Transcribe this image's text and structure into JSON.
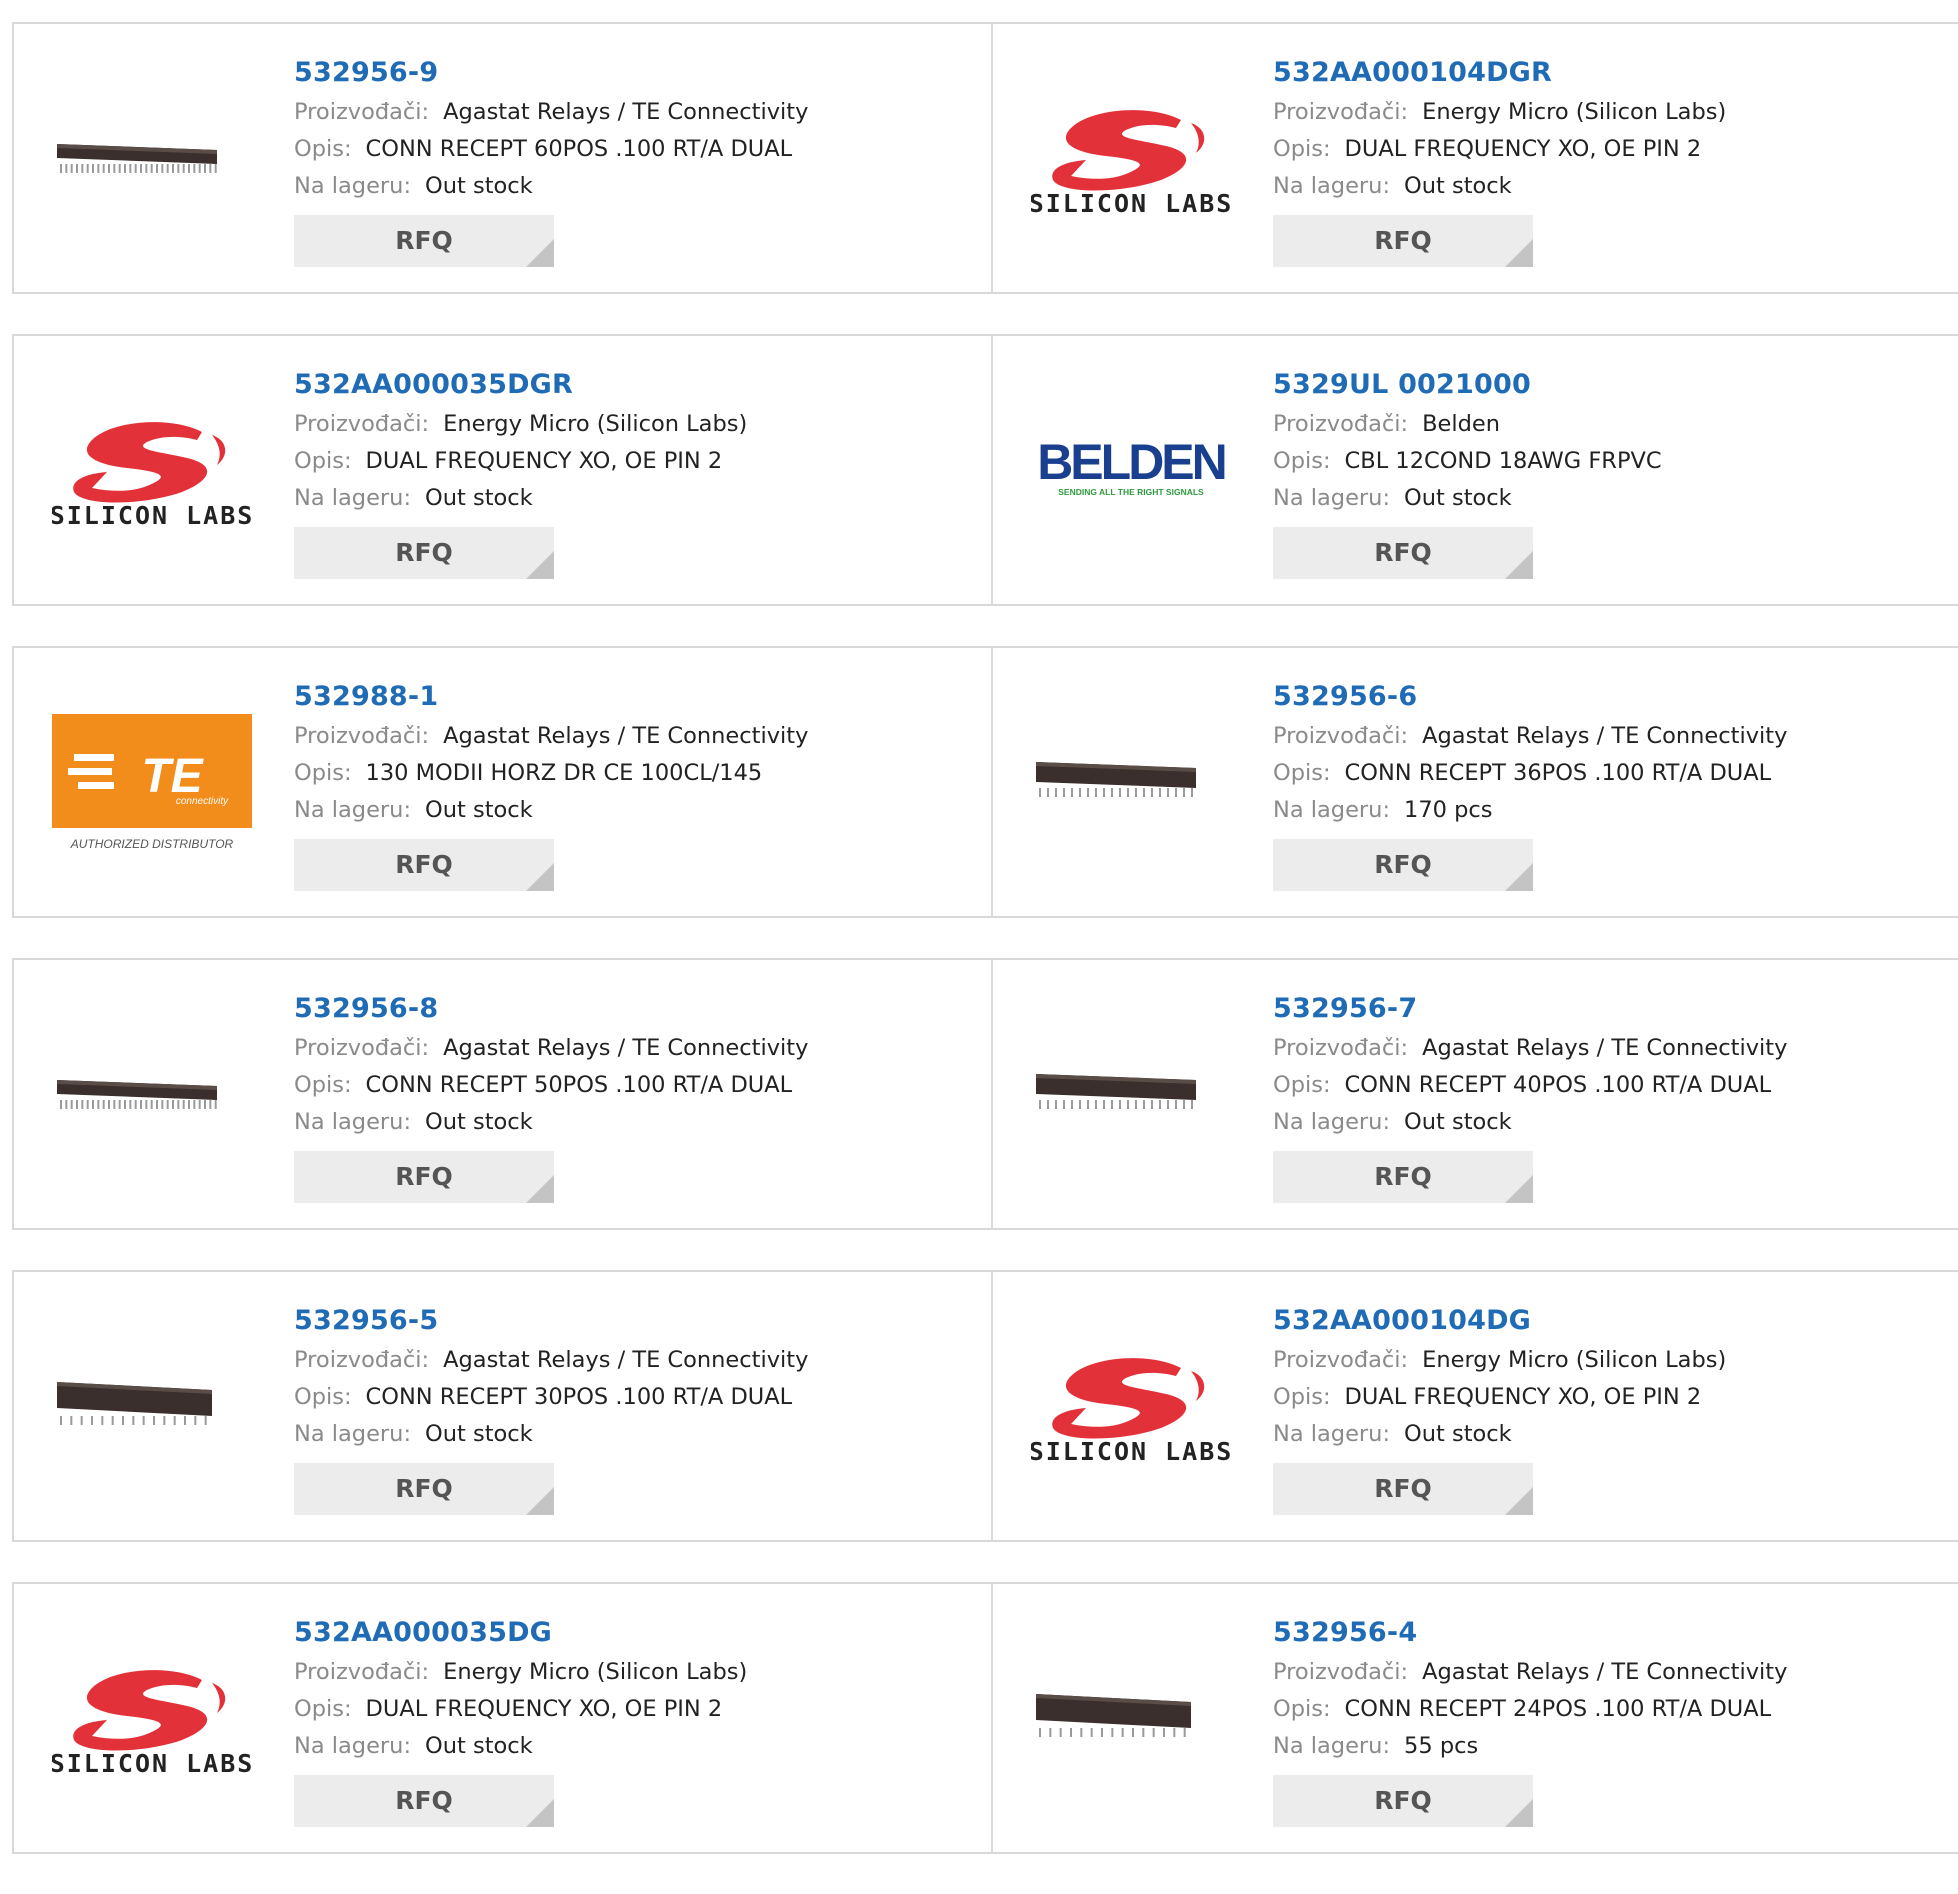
{
  "labels": {
    "manufacturer": "Proizvođači:",
    "description": "Opis:",
    "stock": "Na lageru:",
    "rfq": "RFQ"
  },
  "logo_text": {
    "silicon_labs": "SILICON LABS",
    "belden": "BELDEN",
    "belden_tagline": "SENDING ALL THE RIGHT SIGNALS",
    "te": "TE",
    "te_sub": "connectivity",
    "te_auth": "AUTHORIZED DISTRIBUTOR"
  },
  "colors": {
    "link_blue": "#1f6bb5",
    "silicon_red": "#e23138",
    "te_orange": "#f28c1b",
    "belden_blue": "#1a3f8f",
    "belden_green": "#2e9a3e"
  },
  "products": [
    {
      "pn": "532956-9",
      "mfr": "Agastat Relays / TE Connectivity",
      "desc": "CONN RECEPT 60POS .100 RT/A DUAL",
      "stock": "Out stock",
      "image": "connector-long"
    },
    {
      "pn": "532AA000104DGR",
      "mfr": "Energy Micro (Silicon Labs)",
      "desc": "DUAL FREQUENCY XO, OE PIN 2",
      "stock": "Out stock",
      "image": "silicon-labs-logo"
    },
    {
      "pn": "532AA000035DGR",
      "mfr": "Energy Micro (Silicon Labs)",
      "desc": "DUAL FREQUENCY XO, OE PIN 2",
      "stock": "Out stock",
      "image": "silicon-labs-logo"
    },
    {
      "pn": "5329UL 0021000",
      "mfr": "Belden",
      "desc": "CBL 12COND 18AWG FRPVC",
      "stock": "Out stock",
      "image": "belden-logo"
    },
    {
      "pn": "532988-1",
      "mfr": "Agastat Relays / TE Connectivity",
      "desc": "130 MODII HORZ DR CE 100CL/145",
      "stock": "Out stock",
      "image": "te-logo"
    },
    {
      "pn": "532956-6",
      "mfr": "Agastat Relays / TE Connectivity",
      "desc": "CONN RECEPT 36POS .100 RT/A DUAL",
      "stock": "170 pcs",
      "image": "connector-medium"
    },
    {
      "pn": "532956-8",
      "mfr": "Agastat Relays / TE Connectivity",
      "desc": "CONN RECEPT 50POS .100 RT/A DUAL",
      "stock": "Out stock",
      "image": "connector-long"
    },
    {
      "pn": "532956-7",
      "mfr": "Agastat Relays / TE Connectivity",
      "desc": "CONN RECEPT 40POS .100 RT/A DUAL",
      "stock": "Out stock",
      "image": "connector-medium"
    },
    {
      "pn": "532956-5",
      "mfr": "Agastat Relays / TE Connectivity",
      "desc": "CONN RECEPT 30POS .100 RT/A DUAL",
      "stock": "Out stock",
      "image": "connector-short"
    },
    {
      "pn": "532AA000104DG",
      "mfr": "Energy Micro (Silicon Labs)",
      "desc": "DUAL FREQUENCY XO, OE PIN 2",
      "stock": "Out stock",
      "image": "silicon-labs-logo"
    },
    {
      "pn": "532AA000035DG",
      "mfr": "Energy Micro (Silicon Labs)",
      "desc": "DUAL FREQUENCY XO, OE PIN 2",
      "stock": "Out stock",
      "image": "silicon-labs-logo"
    },
    {
      "pn": "532956-4",
      "mfr": "Agastat Relays / TE Connectivity",
      "desc": "CONN RECEPT 24POS .100 RT/A DUAL",
      "stock": "55 pcs",
      "image": "connector-short"
    }
  ]
}
